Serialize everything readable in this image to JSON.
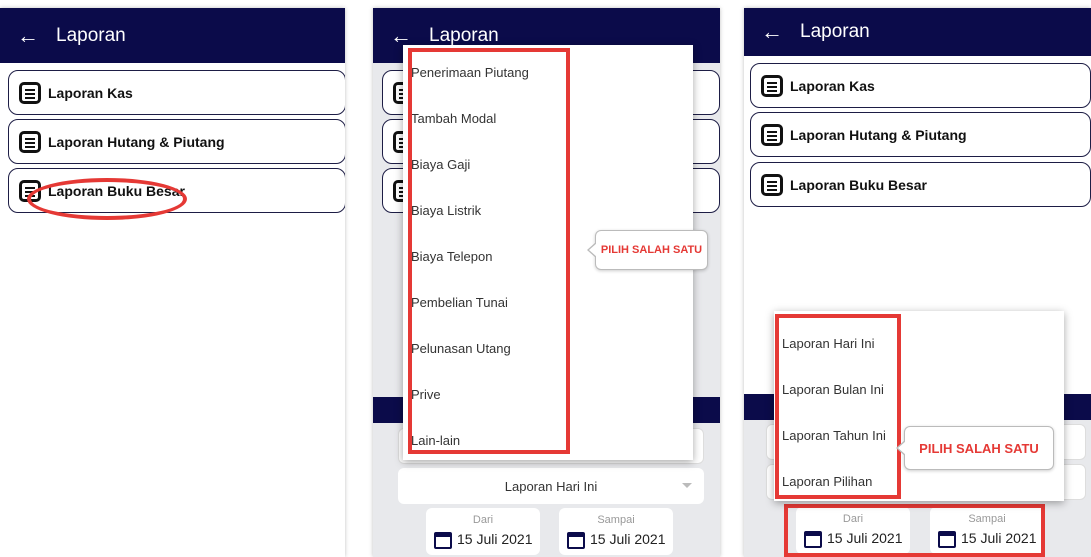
{
  "screen1": {
    "back_icon": "arrow-left-icon",
    "title": "Laporan",
    "menu": [
      {
        "label": "Laporan Kas",
        "icon": "report-icon"
      },
      {
        "label": "Laporan Hutang & Piutang",
        "icon": "report-icon"
      },
      {
        "label": "Laporan Buku Besar",
        "icon": "report-icon"
      }
    ]
  },
  "screen2": {
    "title": "Laporan",
    "dropdown_options": [
      "Penerimaan Piutang",
      "Tambah Modal",
      "Biaya Gaji",
      "Biaya Listrik",
      "Biaya Telepon",
      "Pembelian Tunai",
      "Pelunasan Utang",
      "Prive",
      "Lain-lain"
    ],
    "callout": "PILIH SALAH SATU",
    "period_select": "Laporan Hari Ini",
    "date_from": {
      "caption": "Dari",
      "value": "15 Juli 2021"
    },
    "date_to": {
      "caption": "Sampai",
      "value": "15 Juli 2021"
    }
  },
  "screen3": {
    "title": "Laporan",
    "menu": [
      {
        "label": "Laporan Kas",
        "icon": "report-icon"
      },
      {
        "label": "Laporan Hutang & Piutang",
        "icon": "report-icon"
      },
      {
        "label": "Laporan Buku Besar",
        "icon": "report-icon"
      }
    ],
    "period_options": [
      "Laporan Hari Ini",
      "Laporan Bulan Ini",
      "Laporan Tahun Ini",
      "Laporan Pilihan"
    ],
    "callout": "PILIH SALAH SATU",
    "date_from": {
      "caption": "Dari",
      "value": "15 Juli 2021"
    },
    "date_to": {
      "caption": "Sampai",
      "value": "15 Juli 2021"
    }
  },
  "colors": {
    "appbar": "#0b0b4a",
    "highlight": "#e53935",
    "background_grey": "#e8e9ec"
  }
}
